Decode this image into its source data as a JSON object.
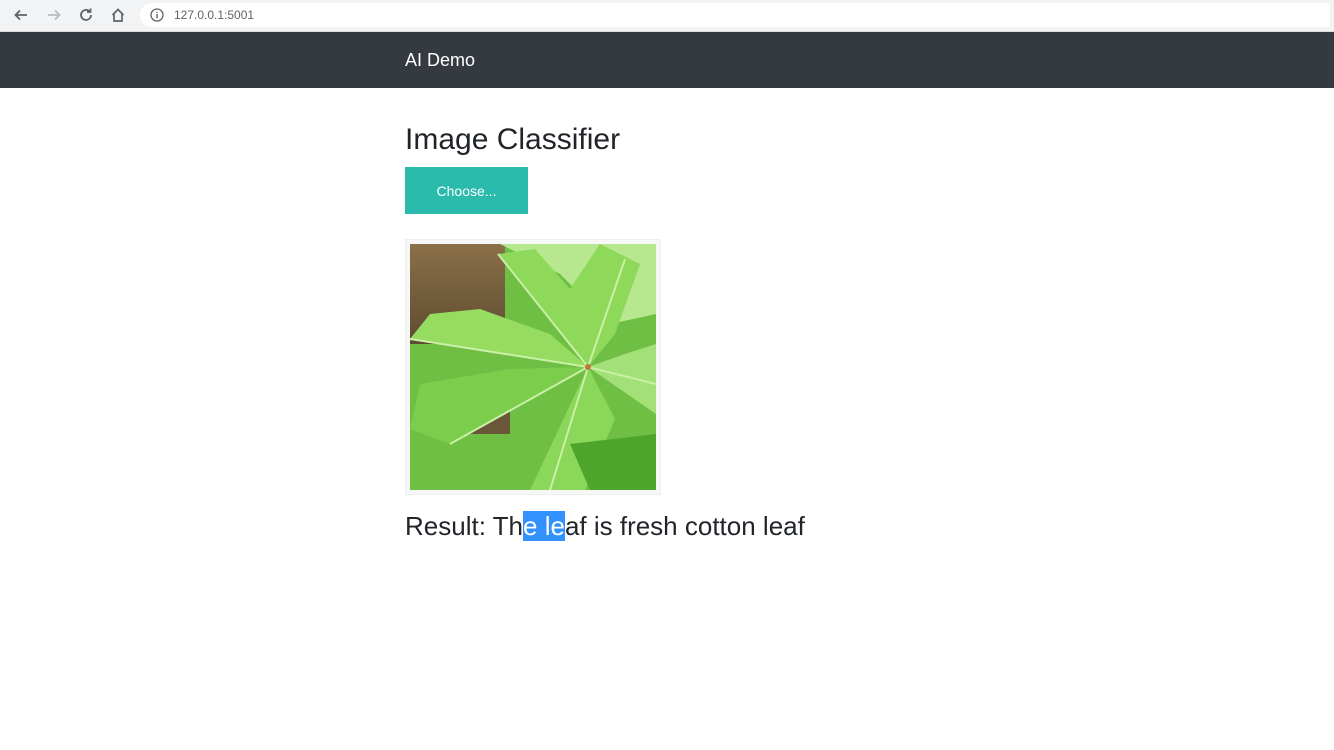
{
  "browser": {
    "url": "127.0.0.1:5001"
  },
  "navbar": {
    "brand": "AI Demo"
  },
  "main": {
    "title": "Image Classifier",
    "choose_label": "Choose...",
    "preview_icon": "cotton-leaf-image"
  },
  "result": {
    "prefix": "Result: Th",
    "highlighted": "e le",
    "suffix": "af is fresh cotton leaf"
  },
  "colors": {
    "navbar_bg": "#343a40",
    "choose_button_bg": "#2bbbad",
    "selection_bg": "#3390ff"
  }
}
